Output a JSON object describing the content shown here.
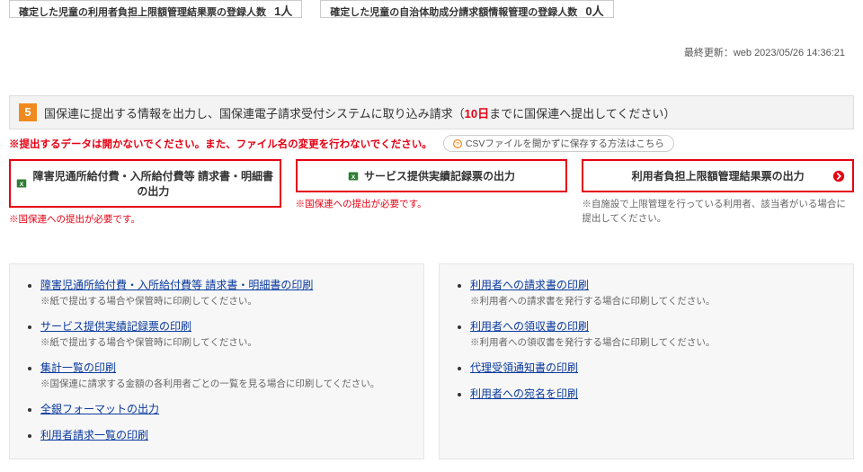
{
  "topCards": {
    "a": {
      "label": "確定した児童の利用者負担上限額管理結果票の登録人数",
      "count": "1人"
    },
    "b": {
      "label": "確定した児童の自治体助成分請求額情報管理の登録人数",
      "count": "0人"
    }
  },
  "lastUpdated": "最終更新：web 2023/05/26 14:36:21",
  "section5": {
    "num": "5",
    "title_a": "国保連に提出する情報を出力し、国保連電子請求受付システムに取り込み請求（",
    "title_red": "10日",
    "title_b": "までに国保連へ提出してください）",
    "warn": "※提出するデータは開かないでください。また、ファイル名の変更を行わないでください。",
    "csvHint": "CSVファイルを開かずに保存する方法はこちら",
    "cols": {
      "c1": {
        "label": "障害児通所給付費・入所給付費等 請求書・明細書の出力",
        "note": "※国保連への提出が必要です。"
      },
      "c2": {
        "label": "サービス提供実績記録票の出力",
        "note": "※国保連への提出が必要です。"
      },
      "c3": {
        "label": "利用者負担上限額管理結果票の出力",
        "note": "※自施設で上限管理を行っている利用者、該当者がいる場合に提出してください。"
      }
    }
  },
  "panels": {
    "left": [
      {
        "link": "障害児通所給付費・入所給付費等 請求書・明細書の印刷",
        "sub": "※紙で提出する場合や保管時に印刷してください。"
      },
      {
        "link": "サービス提供実績記録票の印刷",
        "sub": "※紙で提出する場合や保管時に印刷してください。"
      },
      {
        "link": "集計一覧の印刷",
        "sub": "※国保連に請求する金額の各利用者ごとの一覧を見る場合に印刷してください。"
      },
      {
        "link": "全銀フォーマットの出力",
        "sub": ""
      },
      {
        "link": "利用者請求一覧の印刷",
        "sub": ""
      }
    ],
    "right": [
      {
        "link": "利用者への請求書の印刷",
        "sub": "※利用者への請求書を発行する場合に印刷してください。"
      },
      {
        "link": "利用者への領収書の印刷",
        "sub": "※利用者への領収書を発行する場合に印刷してください。"
      },
      {
        "link": "代理受領通知書の印刷",
        "sub": ""
      },
      {
        "link": "利用者への宛名を印刷",
        "sub": ""
      }
    ]
  }
}
